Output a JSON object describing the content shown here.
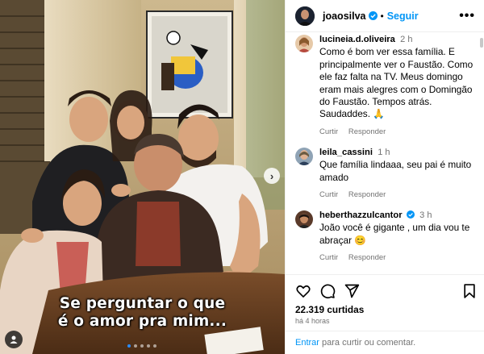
{
  "post": {
    "author": "joaosilva",
    "follow_label": "Seguir",
    "separator": "•",
    "more_label": "•••"
  },
  "media": {
    "caption_line1": "Se perguntar o que",
    "caption_line2": "é o amor pra mim...",
    "next_glyph": "›",
    "slide_count": 5,
    "active_slide": 1
  },
  "comments": [
    {
      "user": "lucineia.d.oliveira",
      "time": "2 h",
      "text": "Como é bom ver essa família. E principalmente ver o Faustão. Como ele faz falta na TV. Meus domingo eram mais alegres com o Domingão do Faustão. Tempos atrás. Saudaddes. 🙏",
      "reply_label": "Responder",
      "like_label": "Curtir"
    },
    {
      "user": "leila_cassini",
      "time": "1 h",
      "text": "Que família lindaaa, seu pai é muito amado",
      "reply_label": "Responder",
      "like_label": "Curtir"
    },
    {
      "user": "heberthazzulcantor",
      "time": "3 h",
      "text": "João você é gigante , um dia vou te abraçar 😊",
      "reply_label": "Responder",
      "like_label": "Curtir",
      "verified": true
    }
  ],
  "engagement": {
    "likes": "22.319 curtidas",
    "time_ago": "há 4 horas"
  },
  "comment_input": {
    "link_label": "Entrar",
    "rest": " para curtir ou comentar."
  },
  "colors": {
    "accent": "#0095f6",
    "verified": "#0095f6",
    "muted": "#737373"
  },
  "icons": [
    "heart-icon",
    "comment-icon",
    "share-icon",
    "bookmark-icon",
    "verified-badge-icon",
    "more-icon",
    "chevron-right-icon",
    "user-tag-icon"
  ]
}
